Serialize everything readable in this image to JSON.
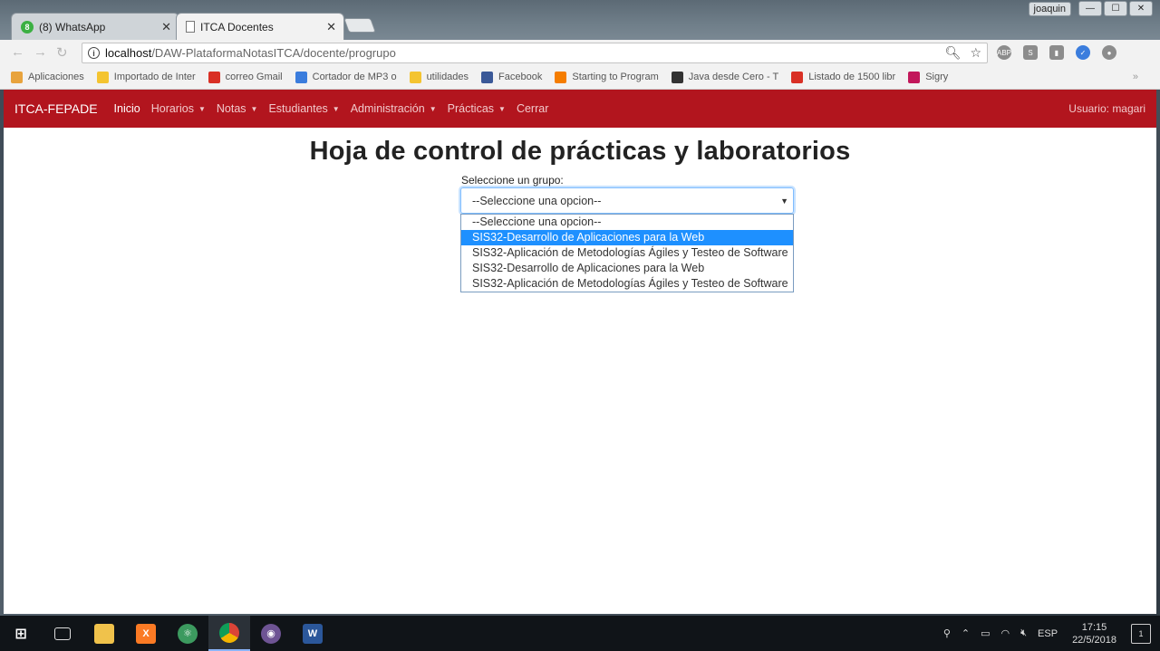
{
  "browser": {
    "tabs": [
      {
        "title": "(8) WhatsApp",
        "icon": "whatsapp-icon",
        "badge": "8"
      },
      {
        "title": "ITCA Docentes",
        "icon": "document-icon"
      }
    ],
    "window_user": "joaquin",
    "url_host": "localhost",
    "url_path": "/DAW-PlataformaNotasITCA/docente/progrupo",
    "bookmarks": [
      {
        "label": "Aplicaciones",
        "color": "#e8a33d"
      },
      {
        "label": "Importado de Inter",
        "color": "#f4c430"
      },
      {
        "label": "correo Gmail",
        "color": "#d93025"
      },
      {
        "label": "Cortador de MP3 o",
        "color": "#3b7ddd"
      },
      {
        "label": "utilidades",
        "color": "#f4c430"
      },
      {
        "label": "Facebook",
        "color": "#3b5998"
      },
      {
        "label": "Starting to Program",
        "color": "#f57d00"
      },
      {
        "label": "Java desde Cero - T",
        "color": "#333333"
      },
      {
        "label": "Listado de 1500 libr",
        "color": "#d93025"
      },
      {
        "label": "Sigry",
        "color": "#c2185b"
      }
    ],
    "bookmarks_more": "»"
  },
  "navbar": {
    "brand": "ITCA-FEPADE",
    "items": [
      {
        "label": "Inicio",
        "dropdown": false,
        "active": true
      },
      {
        "label": "Horarios",
        "dropdown": true
      },
      {
        "label": "Notas",
        "dropdown": true
      },
      {
        "label": "Estudiantes",
        "dropdown": true
      },
      {
        "label": "Administración",
        "dropdown": true
      },
      {
        "label": "Prácticas",
        "dropdown": true
      },
      {
        "label": "Cerrar",
        "dropdown": false
      }
    ],
    "user": "Usuario: magari"
  },
  "main": {
    "title": "Hoja de control de prácticas y laboratorios",
    "select_label": "Seleccione un grupo:",
    "select_value": "--Seleccione una opcion--",
    "options": [
      "--Seleccione una opcion--",
      "SIS32-Desarrollo de Aplicaciones para la Web",
      "SIS32-Aplicación de Metodologías Ágiles y Testeo de Software",
      "SIS32-Desarrollo de Aplicaciones para la Web",
      "SIS32-Aplicación de Metodologías Ágiles y Testeo de Software"
    ],
    "highlighted_option_index": 1
  },
  "taskbar": {
    "language": "ESP",
    "time": "17:15",
    "date": "22/5/2018",
    "notifications": "1"
  },
  "colors": {
    "navbar": "#b2151e",
    "highlight": "#1e90ff"
  }
}
